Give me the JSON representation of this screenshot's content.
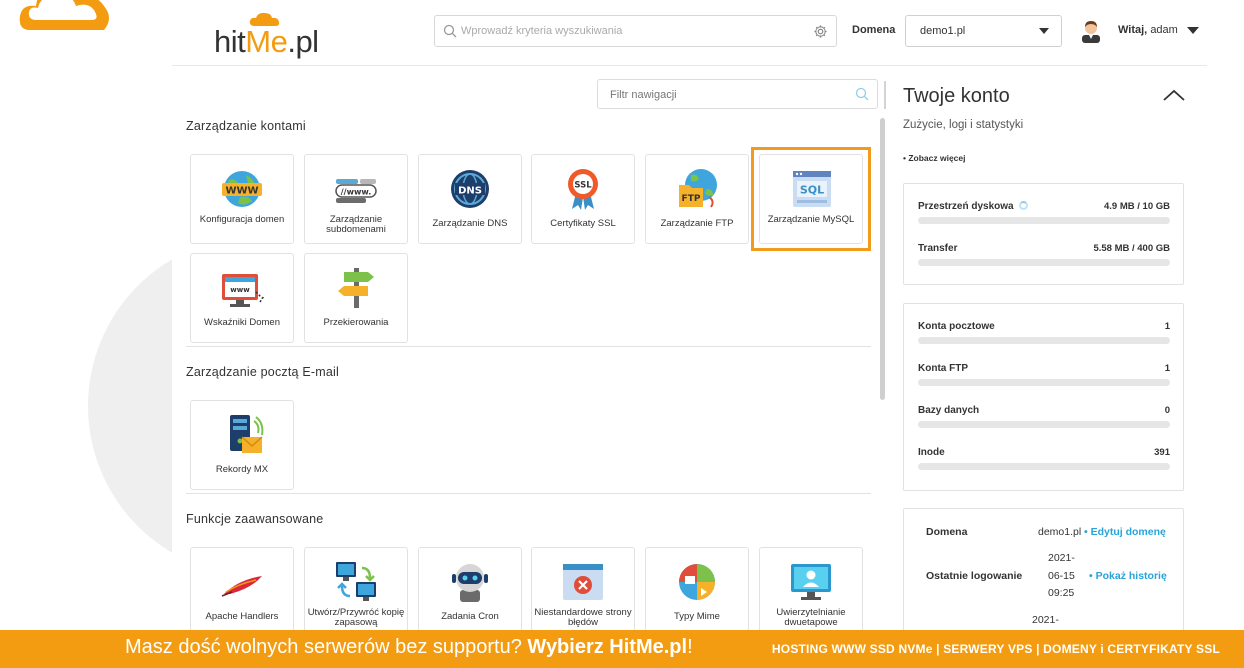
{
  "header": {
    "logo": {
      "part1": "hit",
      "part2": "Me",
      "part3": ".pl"
    },
    "search_placeholder": "Wprowadź kryteria wyszukiwania",
    "domain_label": "Domena",
    "domain_value": "demo1.pl",
    "greeting_bold": "Witaj,",
    "greeting_user": "adam"
  },
  "main": {
    "filter_placeholder": "Filtr nawigacji",
    "sections": [
      {
        "title": "Zarządzanie kontami",
        "tiles": [
          {
            "label": "Konfiguracja domen",
            "icon": "www-globe-icon"
          },
          {
            "label": "Zarządzanie subdomenami",
            "icon": "subdomain-link-icon"
          },
          {
            "label": "Zarządzanie DNS",
            "icon": "dns-globe-icon"
          },
          {
            "label": "Certyfikaty SSL",
            "icon": "ssl-badge-icon"
          },
          {
            "label": "Zarządzanie FTP",
            "icon": "ftp-folder-icon"
          },
          {
            "label": "Zarządzanie MySQL",
            "icon": "sql-database-icon"
          },
          {
            "label": "Wskaźniki Domen",
            "icon": "domain-pointer-icon"
          },
          {
            "label": "Przekierowania",
            "icon": "signpost-icon"
          }
        ]
      },
      {
        "title": "Zarządzanie pocztą E-mail",
        "tiles": [
          {
            "label": "Rekordy MX",
            "icon": "mx-server-icon"
          }
        ]
      },
      {
        "title": "Funkcje zaawansowane",
        "tiles": [
          {
            "label": "Apache Handlers",
            "icon": "apache-feather-icon"
          },
          {
            "label": "Utwórz/Przywróć kopię zapasową",
            "icon": "backup-computers-icon"
          },
          {
            "label": "Zadania Cron",
            "icon": "robot-icon"
          },
          {
            "label": "Niestandardowe strony błędów",
            "icon": "error-page-icon"
          },
          {
            "label": "Typy Mime",
            "icon": "mime-types-icon"
          },
          {
            "label": "Uwierzytelnianie dwuetapowe",
            "icon": "two-factor-monitor-icon"
          }
        ]
      }
    ]
  },
  "account": {
    "title": "Twoje konto",
    "subtitle": "Zużycie, logi i statystyki",
    "more": "• Zobacz więcej",
    "usage": [
      {
        "label": "Przestrzeń dyskowa",
        "value": "4.9 MB / 10 GB",
        "fraction": 0.0
      },
      {
        "label": "Transfer",
        "value": "5.58 MB / 400 GB",
        "fraction": 0.0
      }
    ],
    "counts": [
      {
        "label": "Konta pocztowe",
        "value": "1"
      },
      {
        "label": "Konta FTP",
        "value": "1"
      },
      {
        "label": "Bazy danych",
        "value": "0"
      },
      {
        "label": "Inode",
        "value": "391"
      }
    ],
    "info": {
      "domain_label": "Domena",
      "domain_value": "demo1.pl",
      "domain_link": "• Edytuj domenę",
      "login_label": "Ostatnie logowanie",
      "login_date": "2021-",
      "login_date2": "06-15",
      "login_time": "09:25",
      "login_link": "• Pokaż historię",
      "next_date": "2021-"
    }
  },
  "footer": {
    "text": "Masz dość wolnych serwerów bez supportu?",
    "cta": "Wybierz HitMe.pl",
    "exclaim": "!",
    "right": "HOSTING WWW SSD NVMe | SERWERY VPS | DOMENY i CERTYFIKATY SSL"
  },
  "colors": {
    "accent": "#f39c12",
    "link": "#29a3d8",
    "highlight": "#f29a1c"
  }
}
